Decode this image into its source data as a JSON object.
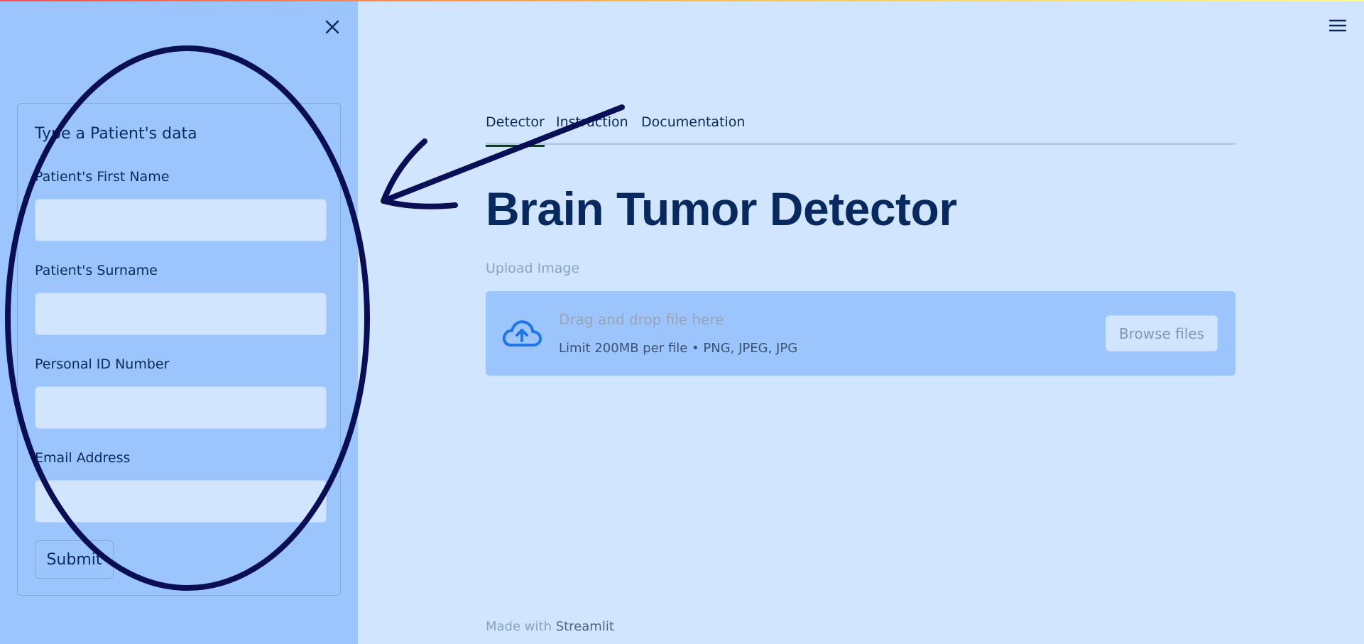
{
  "sidebar": {
    "form_title": "Type a Patient's data",
    "fields": [
      {
        "label": "Patient's First Name",
        "value": ""
      },
      {
        "label": "Patient's Surname",
        "value": ""
      },
      {
        "label": "Personal ID Number",
        "value": ""
      },
      {
        "label": "Email Address",
        "value": ""
      }
    ],
    "submit_label": "Submit"
  },
  "tabs": [
    {
      "label": "Detector",
      "active": true
    },
    {
      "label": "Instruction",
      "active": false
    },
    {
      "label": "Documentation",
      "active": false
    }
  ],
  "main": {
    "title": "Brain Tumor Detector",
    "upload_label": "Upload Image",
    "dropzone": {
      "drag_text": "Drag and drop file here",
      "limit_text": "Limit 200MB per file • PNG, JPEG, JPG",
      "browse_label": "Browse files"
    }
  },
  "footer": {
    "prefix": "Made with ",
    "brand": "Streamlit"
  },
  "colors": {
    "sidebar_bg": "#9bc5fc",
    "main_bg": "#d2e5fe",
    "title": "#08295e",
    "annotation_ink": "#0a0f55",
    "cloud_icon": "#1f77e6"
  },
  "icons": {
    "close": "close-icon",
    "menu": "hamburger-menu-icon",
    "upload": "cloud-upload-icon"
  }
}
